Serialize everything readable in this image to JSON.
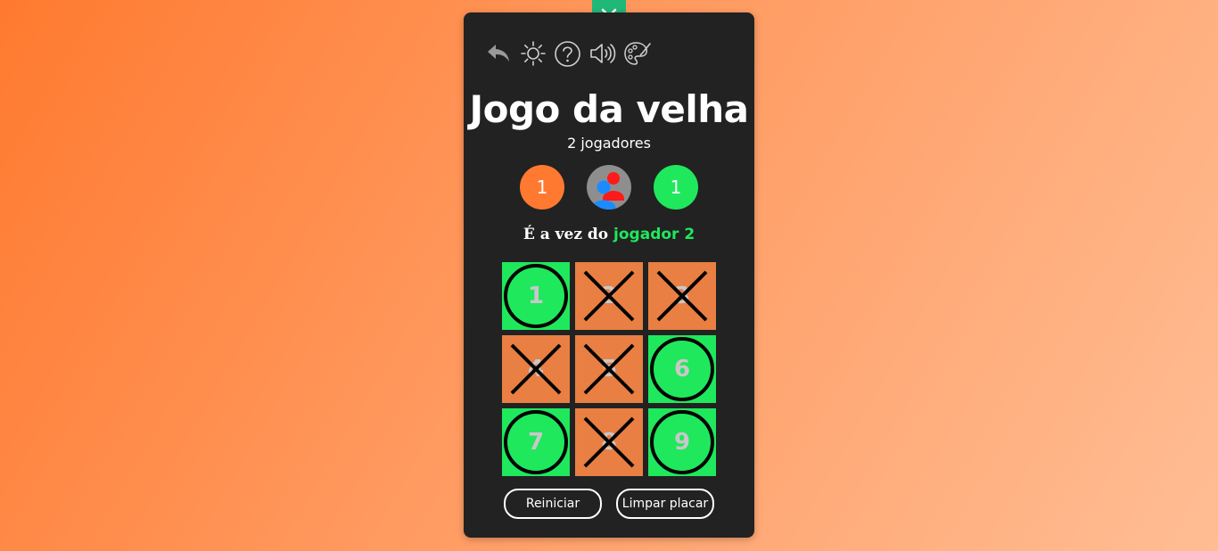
{
  "toggle": {
    "icon": "chevron-down-icon"
  },
  "toolbar": {
    "icons": [
      "back-arrow-icon",
      "brightness-icon",
      "help-icon",
      "sound-icon",
      "palette-icon"
    ]
  },
  "game": {
    "title": "Jogo da velha",
    "mode": "2 jogadores",
    "score_player1": "1",
    "score_player2": "1",
    "turn_prefix": "É a vez do ",
    "turn_player": "jogador 2"
  },
  "board": {
    "cells": [
      {
        "number": "1",
        "mark": "O"
      },
      {
        "number": "2",
        "mark": "X"
      },
      {
        "number": "3",
        "mark": "X"
      },
      {
        "number": "4",
        "mark": "X"
      },
      {
        "number": "5",
        "mark": "X"
      },
      {
        "number": "6",
        "mark": "O"
      },
      {
        "number": "7",
        "mark": "O"
      },
      {
        "number": "8",
        "mark": "X"
      },
      {
        "number": "9",
        "mark": "O"
      }
    ]
  },
  "actions": {
    "restart_label": "Reiniciar",
    "clear_label": "Limpar placar"
  },
  "colors": {
    "player1": "#ff7a30",
    "player2": "#1fe85c",
    "panel": "#222222",
    "accent": "#20b877"
  }
}
